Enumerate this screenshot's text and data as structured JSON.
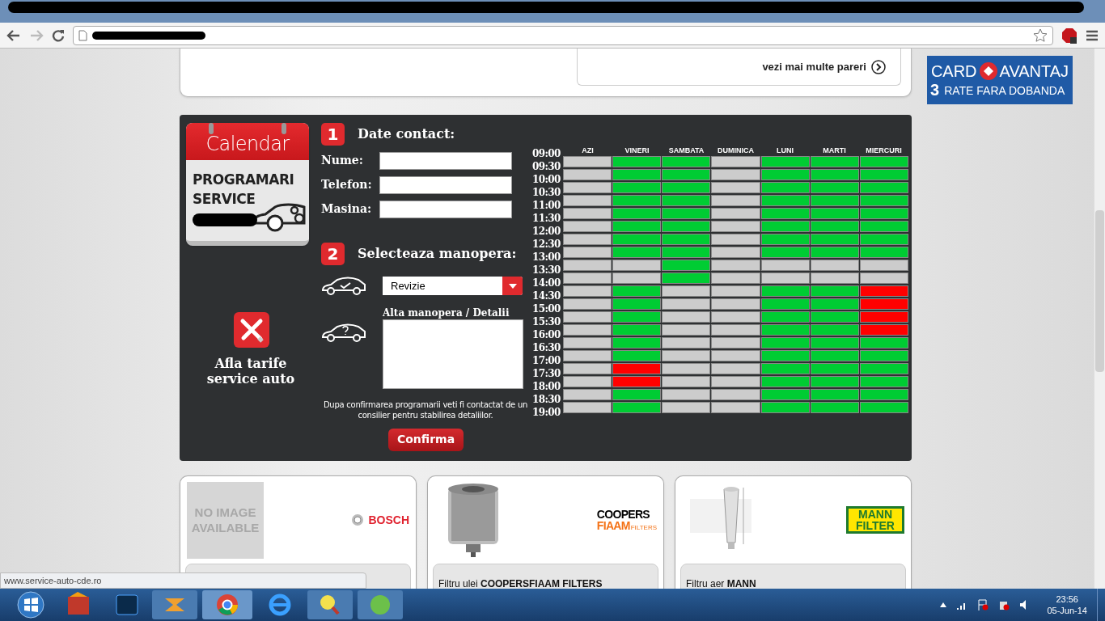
{
  "browser": {
    "status_url": "www.service-auto-cde.ro"
  },
  "reviews": {
    "link": "vezi mai multe pareri"
  },
  "ad": {
    "word1": "CARD",
    "word2": "AVANTAJ",
    "number": "3",
    "line2": "RATE FARA DOBANDA"
  },
  "logo": {
    "title": "Calendar",
    "line1": "PROGRAMARI",
    "line2": "SERVICE"
  },
  "prices_link": "Afla tarife service auto",
  "steps": [
    {
      "number": "1",
      "title": "Date contact:"
    },
    {
      "number": "2",
      "title": "Selecteaza manopera:"
    }
  ],
  "fields": [
    {
      "label": "Nume:"
    },
    {
      "label": "Telefon:"
    },
    {
      "label": "Masina:"
    }
  ],
  "service_select": {
    "value": "Revizie"
  },
  "details": {
    "label": "Alta manopera / Detalii"
  },
  "note": "Dupa confirmarea programarii veti fi contactat de un consilier pentru stabilirea detaliilor.",
  "confirm_button": "Confirma",
  "schedule": {
    "columns": [
      "AZI",
      "VINERI",
      "SAMBATA",
      "DUMINICA",
      "LUNI",
      "MARTI",
      "MIERCURI"
    ],
    "times": [
      "09:00",
      "09:30",
      "10:00",
      "10:30",
      "11:00",
      "11:30",
      "12:00",
      "12:30",
      "13:00",
      "13:30",
      "14:00",
      "14:30",
      "15:00",
      "15:30",
      "16:00",
      "16:30",
      "17:00",
      "17:30",
      "18:00",
      "18:30",
      "19:00"
    ],
    "rows": [
      {
        "cells": [
          {
            "kind": "closed"
          },
          {
            "kind": "free"
          },
          {
            "kind": "free"
          },
          {
            "kind": "closed"
          },
          {
            "kind": "free"
          },
          {
            "kind": "free"
          },
          {
            "kind": "free"
          }
        ]
      },
      {
        "cells": [
          {
            "kind": "closed"
          },
          {
            "kind": "free"
          },
          {
            "kind": "free"
          },
          {
            "kind": "closed"
          },
          {
            "kind": "free"
          },
          {
            "kind": "free"
          },
          {
            "kind": "free"
          }
        ]
      },
      {
        "cells": [
          {
            "kind": "closed"
          },
          {
            "kind": "free"
          },
          {
            "kind": "free"
          },
          {
            "kind": "closed"
          },
          {
            "kind": "free"
          },
          {
            "kind": "free"
          },
          {
            "kind": "free"
          }
        ]
      },
      {
        "cells": [
          {
            "kind": "closed"
          },
          {
            "kind": "free"
          },
          {
            "kind": "free"
          },
          {
            "kind": "closed"
          },
          {
            "kind": "free"
          },
          {
            "kind": "free"
          },
          {
            "kind": "free"
          }
        ]
      },
      {
        "cells": [
          {
            "kind": "closed"
          },
          {
            "kind": "free"
          },
          {
            "kind": "free"
          },
          {
            "kind": "closed"
          },
          {
            "kind": "free"
          },
          {
            "kind": "free"
          },
          {
            "kind": "free"
          }
        ]
      },
      {
        "cells": [
          {
            "kind": "closed"
          },
          {
            "kind": "free"
          },
          {
            "kind": "free"
          },
          {
            "kind": "closed"
          },
          {
            "kind": "free"
          },
          {
            "kind": "free"
          },
          {
            "kind": "free"
          }
        ]
      },
      {
        "cells": [
          {
            "kind": "closed"
          },
          {
            "kind": "free"
          },
          {
            "kind": "free"
          },
          {
            "kind": "closed"
          },
          {
            "kind": "free"
          },
          {
            "kind": "free"
          },
          {
            "kind": "free"
          }
        ]
      },
      {
        "cells": [
          {
            "kind": "closed"
          },
          {
            "kind": "free"
          },
          {
            "kind": "free"
          },
          {
            "kind": "closed"
          },
          {
            "kind": "free"
          },
          {
            "kind": "free"
          },
          {
            "kind": "free"
          }
        ]
      },
      {
        "cells": [
          {
            "kind": "closed"
          },
          {
            "kind": "closed"
          },
          {
            "kind": "free"
          },
          {
            "kind": "closed"
          },
          {
            "kind": "closed"
          },
          {
            "kind": "closed"
          },
          {
            "kind": "closed"
          }
        ]
      },
      {
        "cells": [
          {
            "kind": "closed"
          },
          {
            "kind": "closed"
          },
          {
            "kind": "free"
          },
          {
            "kind": "closed"
          },
          {
            "kind": "closed"
          },
          {
            "kind": "closed"
          },
          {
            "kind": "closed"
          }
        ]
      },
      {
        "cells": [
          {
            "kind": "closed"
          },
          {
            "kind": "free"
          },
          {
            "kind": "closed"
          },
          {
            "kind": "closed"
          },
          {
            "kind": "free"
          },
          {
            "kind": "free"
          },
          {
            "kind": "booked"
          }
        ]
      },
      {
        "cells": [
          {
            "kind": "closed"
          },
          {
            "kind": "free"
          },
          {
            "kind": "closed"
          },
          {
            "kind": "closed"
          },
          {
            "kind": "free"
          },
          {
            "kind": "free"
          },
          {
            "kind": "booked"
          }
        ]
      },
      {
        "cells": [
          {
            "kind": "closed"
          },
          {
            "kind": "free"
          },
          {
            "kind": "closed"
          },
          {
            "kind": "closed"
          },
          {
            "kind": "free"
          },
          {
            "kind": "free"
          },
          {
            "kind": "booked"
          }
        ]
      },
      {
        "cells": [
          {
            "kind": "closed"
          },
          {
            "kind": "free"
          },
          {
            "kind": "closed"
          },
          {
            "kind": "closed"
          },
          {
            "kind": "free"
          },
          {
            "kind": "free"
          },
          {
            "kind": "booked"
          }
        ]
      },
      {
        "cells": [
          {
            "kind": "closed"
          },
          {
            "kind": "free"
          },
          {
            "kind": "closed"
          },
          {
            "kind": "closed"
          },
          {
            "kind": "free"
          },
          {
            "kind": "free"
          },
          {
            "kind": "free"
          }
        ]
      },
      {
        "cells": [
          {
            "kind": "closed"
          },
          {
            "kind": "free"
          },
          {
            "kind": "closed"
          },
          {
            "kind": "closed"
          },
          {
            "kind": "free"
          },
          {
            "kind": "free"
          },
          {
            "kind": "free"
          }
        ]
      },
      {
        "cells": [
          {
            "kind": "closed"
          },
          {
            "kind": "booked"
          },
          {
            "kind": "closed"
          },
          {
            "kind": "closed"
          },
          {
            "kind": "free"
          },
          {
            "kind": "free"
          },
          {
            "kind": "free"
          }
        ]
      },
      {
        "cells": [
          {
            "kind": "closed"
          },
          {
            "kind": "booked"
          },
          {
            "kind": "closed"
          },
          {
            "kind": "closed"
          },
          {
            "kind": "free"
          },
          {
            "kind": "free"
          },
          {
            "kind": "free"
          }
        ]
      },
      {
        "cells": [
          {
            "kind": "closed"
          },
          {
            "kind": "free"
          },
          {
            "kind": "closed"
          },
          {
            "kind": "closed"
          },
          {
            "kind": "free"
          },
          {
            "kind": "free"
          },
          {
            "kind": "free"
          }
        ]
      },
      {
        "cells": [
          {
            "kind": "closed"
          },
          {
            "kind": "free"
          },
          {
            "kind": "closed"
          },
          {
            "kind": "closed"
          },
          {
            "kind": "free"
          },
          {
            "kind": "free"
          },
          {
            "kind": "free"
          }
        ]
      }
    ]
  },
  "products": [
    {
      "kind": "no-image",
      "brand_lines": [
        "BOSCH"
      ],
      "placeholder_text": "NO IMAGE AVAILABLE"
    },
    {
      "kind": "oil-filter",
      "brand_lines": [
        "COOPERS",
        "FIAAM",
        "FILTERS"
      ],
      "caption": "Filtru ulei **COOPERSFIAAM FILTERS**"
    },
    {
      "kind": "air-filter",
      "brand_lines": [
        "MANN",
        "FILTER"
      ],
      "caption": "Filtru aer **MANN**"
    }
  ],
  "clock": {
    "time": "23:56",
    "date": "05-Jun-14"
  }
}
